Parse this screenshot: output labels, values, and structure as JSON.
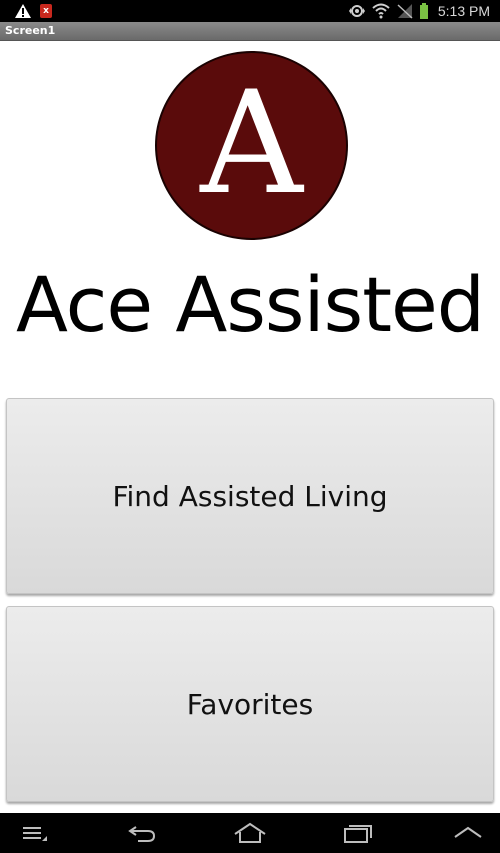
{
  "status_bar": {
    "time": "5:13 PM",
    "icons": [
      "warning-icon",
      "app-notification-icon",
      "sync-icon",
      "wifi-icon",
      "signal-icon",
      "battery-icon"
    ],
    "notif_badge": "x",
    "battery_color": "#7ac143"
  },
  "title_bar": {
    "title": "Screen1"
  },
  "logo": {
    "letter": "A",
    "color": "#5a0b0b"
  },
  "app_name": "Ace Assisted",
  "buttons": {
    "find_label": "Find Assisted Living",
    "favorites_label": "Favorites"
  },
  "nav_bar": {
    "icons": [
      "menu-icon",
      "back-icon",
      "home-icon",
      "recent-apps-icon",
      "chevron-up-icon"
    ]
  }
}
